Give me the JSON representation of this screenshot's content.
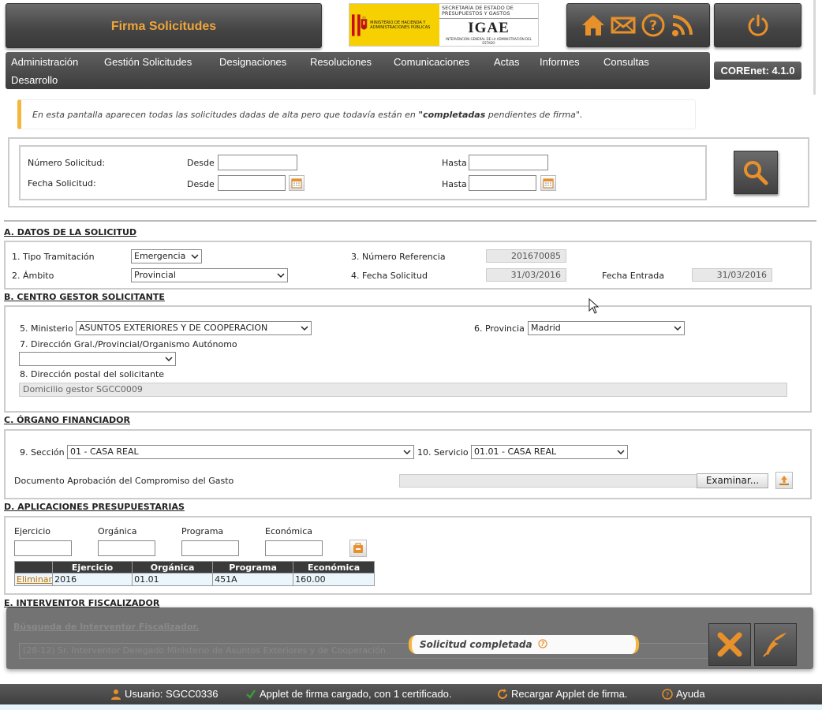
{
  "header": {
    "title": "Firma Solicitudes",
    "logo": {
      "ministry_text": "MINISTERIO DE HACIENDA Y ADMINISTRACIONES PÚBLICAS",
      "secretaria": "SECRETARÍA DE ESTADO DE PRESUPUESTOS Y GASTOS",
      "igae": "IGAE",
      "igae_sub": "INTERVENCIÓN GENERAL DE LA ADMINISTRACIÓN DEL ESTADO"
    },
    "icons": [
      "home-icon",
      "mail-icon",
      "help-icon",
      "rss-icon"
    ],
    "power_icon": "power-icon",
    "version": "COREnet: 4.1.0",
    "accent_color": "#f0a53a"
  },
  "menu": [
    "Administración",
    "Gestión Solicitudes",
    "Designaciones",
    "Resoluciones",
    "Comunicaciones",
    "Actas",
    "Informes",
    "Consultas",
    "Desarrollo"
  ],
  "notice": {
    "before": "En esta pantalla aparecen todas las solicitudes dadas de alta pero que todavía están en ",
    "highlight": "\"completadas",
    "after": " pendientes de firma\"."
  },
  "search": {
    "numero_label": "Número Solicitud:",
    "fecha_label": "Fecha Solicitud:",
    "desde": "Desde",
    "hasta": "Hasta",
    "numero_desde": "",
    "numero_hasta": "",
    "fecha_desde": "",
    "fecha_hasta": ""
  },
  "sectionA": {
    "title": "A. DATOS DE LA SOLICITUD",
    "tipo_label": "1. Tipo Tramitación",
    "tipo_value": "Emergencia",
    "ambito_label": "2. Ámbito",
    "ambito_value": "Provincial",
    "ref_label": "3. Número Referencia",
    "ref_value": "201670085",
    "fecha_label": "4. Fecha Solicitud",
    "fecha_value": "31/03/2016",
    "entrada_label": "Fecha Entrada",
    "entrada_value": "31/03/2016"
  },
  "sectionB": {
    "title": "B. CENTRO GESTOR SOLICITANTE",
    "ministerio_label": "5. Ministerio",
    "ministerio_value": "ASUNTOS EXTERIORES Y DE COOPERACION",
    "provincia_label": "6. Provincia",
    "provincia_value": "Madrid",
    "direccion_label": "7. Dirección Gral./Provincial/Organismo Autónomo",
    "direccion_value": "",
    "postal_label": "8. Dirección postal del solicitante",
    "postal_value": "Domicilio gestor SGCC0009"
  },
  "sectionC": {
    "title": "C. ÓRGANO FINANCIADOR",
    "seccion_label": "9. Sección",
    "seccion_value": "01 - CASA REAL",
    "servicio_label": "10. Servicio",
    "servicio_value": "01.01 - CASA REAL",
    "doc_label": "Documento Aprobación del Compromiso del Gasto",
    "browse": "Examinar..."
  },
  "sectionD": {
    "title": "D. APLICACIONES PRESUPUESTARIAS",
    "labels": [
      "Ejercicio",
      "Orgánica",
      "Programa",
      "Económica"
    ],
    "table": {
      "headers": [
        "",
        "Ejercicio",
        "Orgánica",
        "Programa",
        "Económica"
      ],
      "rows": [
        [
          "Eliminar",
          "2016",
          "01.01",
          "451A",
          "160.00"
        ]
      ]
    }
  },
  "sectionE": {
    "title": "E. INTERVENTOR FISCALIZADOR",
    "link": "Búsqueda de Interventor Fiscalizador.",
    "value": "(28-12) Sr. Interventor Delegado Ministerio de Asuntos Exteriores y de Cooperación."
  },
  "toast": "Solicitud completada",
  "status": {
    "user": "Usuario: SGCC0336",
    "applet": "Applet de firma cargado, con 1 certificado.",
    "reload": "Recargar Applet de firma.",
    "help": "Ayuda"
  }
}
